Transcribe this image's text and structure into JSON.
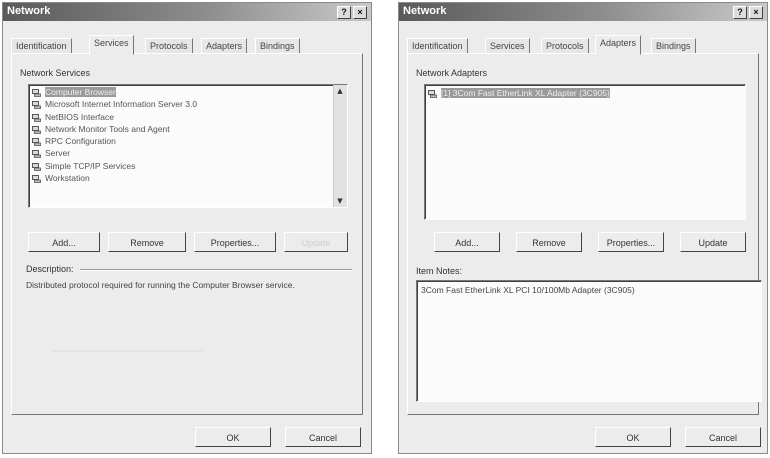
{
  "left_window": {
    "title": "Network",
    "help_btn": "?",
    "close_btn": "×",
    "tabs": [
      "Identification",
      "Services",
      "Protocols",
      "Adapters",
      "Bindings"
    ],
    "active_tab": "Services",
    "list_label": "Network Services",
    "services": [
      "Computer Browser",
      "Microsoft Internet Information Server 3.0",
      "NetBIOS Interface",
      "Network Monitor Tools and Agent",
      "RPC Configuration",
      "Server",
      "Simple TCP/IP Services",
      "Workstation"
    ],
    "selected_index": 0,
    "buttons": {
      "add": "Add...",
      "remove": "Remove",
      "properties": "Properties...",
      "update": "Update"
    },
    "description_label": "Description:",
    "description_text": "Distributed protocol required for running the Computer Browser service.",
    "ok": "OK",
    "cancel": "Cancel"
  },
  "right_window": {
    "title": "Network",
    "help_btn": "?",
    "close_btn": "×",
    "tabs": [
      "Identification",
      "Services",
      "Protocols",
      "Adapters",
      "Bindings"
    ],
    "active_tab": "Adapters",
    "list_label": "Network Adapters",
    "adapters": [
      "[1] 3Com Fast EtherLink XL Adapter (3C905)"
    ],
    "selected_index": 0,
    "buttons": {
      "add": "Add...",
      "remove": "Remove",
      "properties": "Properties...",
      "update": "Update"
    },
    "notes_label": "Item Notes:",
    "notes_text": "3Com Fast EtherLink XL PCI 10/100Mb Adapter (3C905)",
    "ok": "OK",
    "cancel": "Cancel"
  },
  "icons": {
    "network_service": "network-component-icon",
    "scroll_up": "scroll-up-arrow-icon",
    "scroll_down": "scroll-down-arrow-icon"
  }
}
